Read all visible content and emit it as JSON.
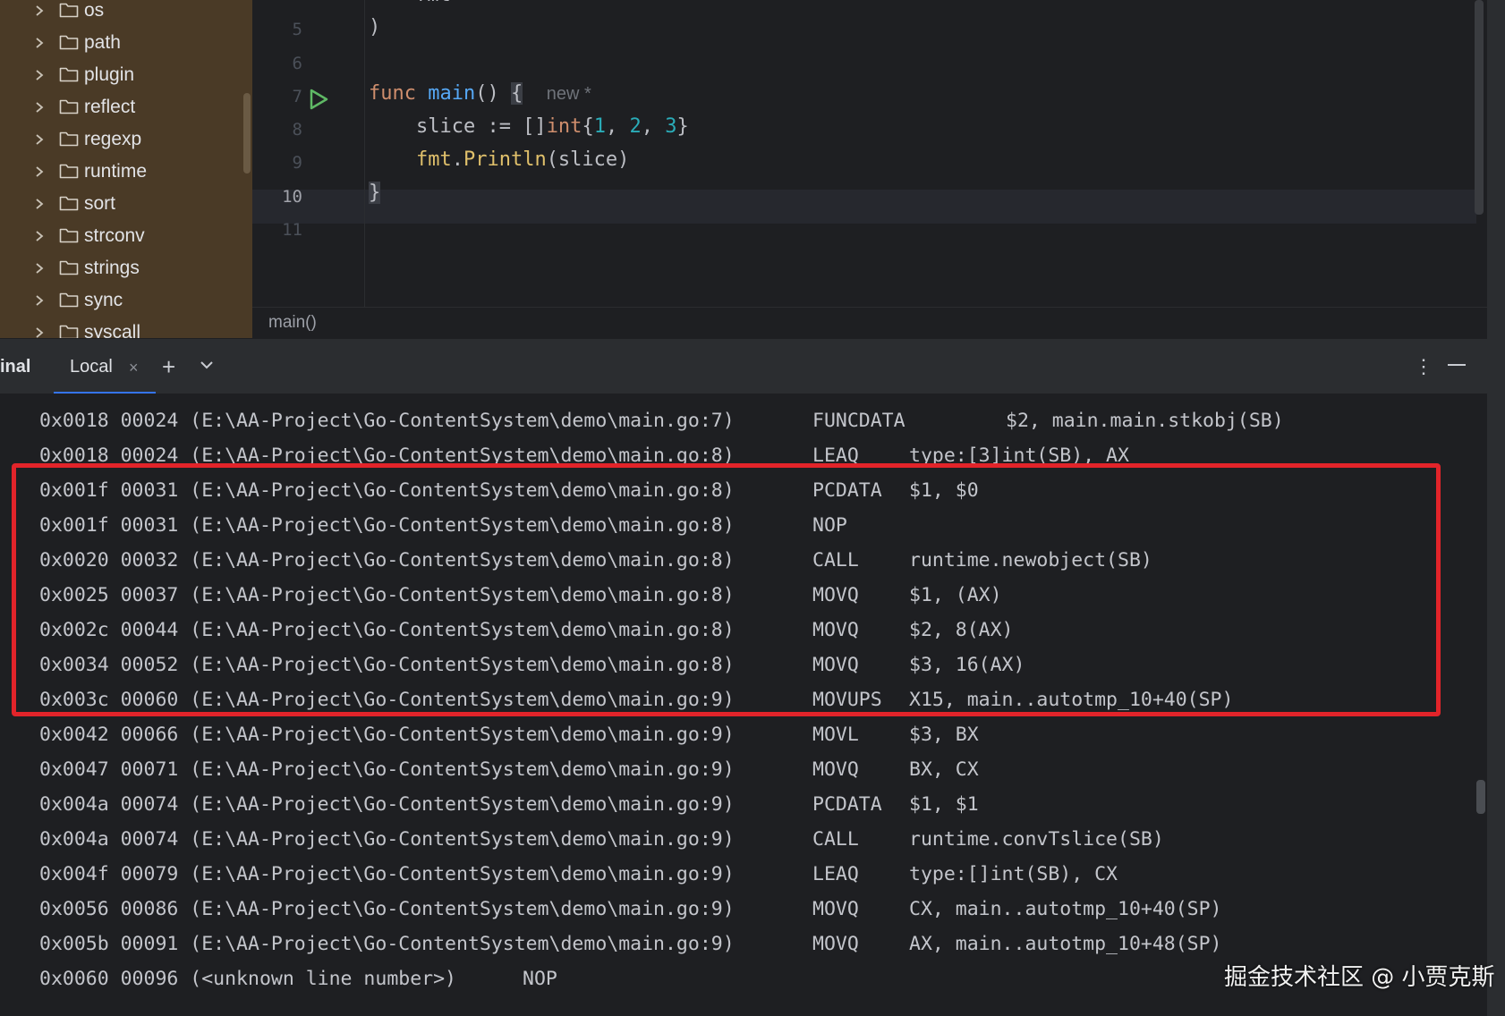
{
  "project_tree": {
    "items": [
      {
        "label": "os"
      },
      {
        "label": "path"
      },
      {
        "label": "plugin"
      },
      {
        "label": "reflect"
      },
      {
        "label": "regexp"
      },
      {
        "label": "runtime"
      },
      {
        "label": "sort"
      },
      {
        "label": "strconv"
      },
      {
        "label": "strings"
      },
      {
        "label": "sync"
      },
      {
        "label": "syscall"
      }
    ]
  },
  "editor": {
    "line_numbers": [
      "5",
      "6",
      "7",
      "8",
      "9",
      "10",
      "11"
    ],
    "current_line": "10",
    "lines": {
      "l5": ")",
      "l7_kw": "func",
      "l7_fn": "main",
      "l7_rest": "() ",
      "l7_brace": "{",
      "l7_hint": "new *",
      "l8_a": "    slice := []",
      "l8_type": "int",
      "l8_b": "{",
      "l8_n1": "1",
      "l8_c": ", ",
      "l8_n2": "2",
      "l8_d": ", ",
      "l8_n3": "3",
      "l8_e": "}",
      "l9_pkg": "    fmt",
      "l9_dot": ".",
      "l9_call": "Println",
      "l9_rest": "(slice)",
      "l10": "}",
      "top_partial": "fmt"
    }
  },
  "breadcrumb": {
    "text": "main()"
  },
  "terminal_bar": {
    "title": "inal",
    "tab_label": "Local",
    "close_glyph": "×",
    "plus_glyph": "+",
    "more_glyph": "⋮"
  },
  "terminal": {
    "rows": [
      {
        "addr": "0x0018 00024 (E:\\AA-Project\\Go-ContentSystem\\demo\\main.go:7)",
        "op": "FUNCDATA",
        "args": "$2, main.main.stkobj(SB)"
      },
      {
        "addr": "0x0018 00024 (E:\\AA-Project\\Go-ContentSystem\\demo\\main.go:8)",
        "op": "LEAQ",
        "args": "type:[3]int(SB), AX"
      },
      {
        "addr": "0x001f 00031 (E:\\AA-Project\\Go-ContentSystem\\demo\\main.go:8)",
        "op": "PCDATA",
        "args": "$1, $0"
      },
      {
        "addr": "0x001f 00031 (E:\\AA-Project\\Go-ContentSystem\\demo\\main.go:8)",
        "op": "NOP",
        "args": ""
      },
      {
        "addr": "0x0020 00032 (E:\\AA-Project\\Go-ContentSystem\\demo\\main.go:8)",
        "op": "CALL",
        "args": "runtime.newobject(SB)"
      },
      {
        "addr": "0x0025 00037 (E:\\AA-Project\\Go-ContentSystem\\demo\\main.go:8)",
        "op": "MOVQ",
        "args": "$1, (AX)"
      },
      {
        "addr": "0x002c 00044 (E:\\AA-Project\\Go-ContentSystem\\demo\\main.go:8)",
        "op": "MOVQ",
        "args": "$2, 8(AX)"
      },
      {
        "addr": "0x0034 00052 (E:\\AA-Project\\Go-ContentSystem\\demo\\main.go:8)",
        "op": "MOVQ",
        "args": "$3, 16(AX)"
      },
      {
        "addr": "0x003c 00060 (E:\\AA-Project\\Go-ContentSystem\\demo\\main.go:9)",
        "op": "MOVUPS",
        "args": "X15, main..autotmp_10+40(SP)"
      },
      {
        "addr": "0x0042 00066 (E:\\AA-Project\\Go-ContentSystem\\demo\\main.go:9)",
        "op": "MOVL",
        "args": "$3, BX"
      },
      {
        "addr": "0x0047 00071 (E:\\AA-Project\\Go-ContentSystem\\demo\\main.go:9)",
        "op": "MOVQ",
        "args": "BX, CX"
      },
      {
        "addr": "0x004a 00074 (E:\\AA-Project\\Go-ContentSystem\\demo\\main.go:9)",
        "op": "PCDATA",
        "args": "$1, $1"
      },
      {
        "addr": "0x004a 00074 (E:\\AA-Project\\Go-ContentSystem\\demo\\main.go:9)",
        "op": "CALL",
        "args": "runtime.convTslice(SB)"
      },
      {
        "addr": "0x004f 00079 (E:\\AA-Project\\Go-ContentSystem\\demo\\main.go:9)",
        "op": "LEAQ",
        "args": "type:[]int(SB), CX"
      },
      {
        "addr": "0x0056 00086 (E:\\AA-Project\\Go-ContentSystem\\demo\\main.go:9)",
        "op": "MOVQ",
        "args": "CX, main..autotmp_10+40(SP)"
      },
      {
        "addr": "0x005b 00091 (E:\\AA-Project\\Go-ContentSystem\\demo\\main.go:9)",
        "op": "MOVQ",
        "args": "AX, main..autotmp_10+48(SP)"
      },
      {
        "addr": "0x0060 00096 (<unknown line number>)",
        "op": "NOP",
        "args": ""
      }
    ]
  },
  "watermark": "掘金技术社区 @ 小贾克斯"
}
